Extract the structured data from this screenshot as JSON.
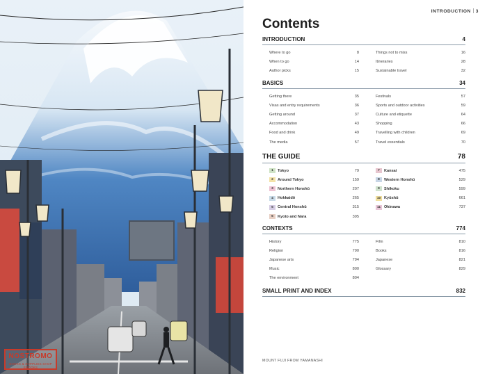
{
  "running_head": "INTRODUCTION",
  "folio": "3",
  "title": "Contents",
  "watermark": {
    "main": "NOSTROMO",
    "sub": "BOOKS & SUPPLIES SHOP EBOOKS"
  },
  "caption": "MOUNT FUJI FROM YAMANASHI",
  "sections": {
    "introduction": {
      "heading": "INTRODUCTION",
      "page": "4",
      "left": [
        {
          "label": "Where to go",
          "page": "8"
        },
        {
          "label": "When to go",
          "page": "14"
        },
        {
          "label": "Author picks",
          "page": "15"
        }
      ],
      "right": [
        {
          "label": "Things not to miss",
          "page": "16"
        },
        {
          "label": "Itineraries",
          "page": "28"
        },
        {
          "label": "Sustainable travel",
          "page": "32"
        }
      ]
    },
    "basics": {
      "heading": "BASICS",
      "page": "34",
      "left": [
        {
          "label": "Getting there",
          "page": "35"
        },
        {
          "label": "Visas and entry requirements",
          "page": "36"
        },
        {
          "label": "Getting around",
          "page": "37"
        },
        {
          "label": "Accommodation",
          "page": "43"
        },
        {
          "label": "Food and drink",
          "page": "49"
        },
        {
          "label": "The media",
          "page": "57"
        }
      ],
      "right": [
        {
          "label": "Festivals",
          "page": "57"
        },
        {
          "label": "Sports and outdoor activities",
          "page": "59"
        },
        {
          "label": "Culture and etiquette",
          "page": "64"
        },
        {
          "label": "Shopping",
          "page": "66"
        },
        {
          "label": "Travelling with children",
          "page": "69"
        },
        {
          "label": "Travel essentials",
          "page": "70"
        }
      ]
    },
    "guide": {
      "heading": "THE GUIDE",
      "page": "78",
      "left": [
        {
          "n": "1",
          "label": "Tokyo",
          "page": "79",
          "color": "#cfe3c6"
        },
        {
          "n": "2",
          "label": "Around Tokyo",
          "page": "159",
          "color": "#f4e2a8"
        },
        {
          "n": "3",
          "label": "Northern Honshū",
          "page": "207",
          "color": "#eec3d3"
        },
        {
          "n": "4",
          "label": "Hokkaidō",
          "page": "265",
          "color": "#c9dbe8"
        },
        {
          "n": "5",
          "label": "Central Honshū",
          "page": "315",
          "color": "#d6cde4"
        },
        {
          "n": "6",
          "label": "Kyoto and Nara",
          "page": "395",
          "color": "#e8d0c4"
        }
      ],
      "right": [
        {
          "n": "7",
          "label": "Kansai",
          "page": "475",
          "color": "#e7c6cf"
        },
        {
          "n": "8",
          "label": "Western Honshū",
          "page": "529",
          "color": "#c8d6e6"
        },
        {
          "n": "9",
          "label": "Shikoku",
          "page": "599",
          "color": "#cfe2cd"
        },
        {
          "n": "10",
          "label": "Kyūshū",
          "page": "661",
          "color": "#f1df9e"
        },
        {
          "n": "11",
          "label": "Okinawa",
          "page": "737",
          "color": "#e9c7d8"
        }
      ]
    },
    "contexts": {
      "heading": "CONTEXTS",
      "page": "774",
      "left": [
        {
          "label": "History",
          "page": "775"
        },
        {
          "label": "Religion",
          "page": "790"
        },
        {
          "label": "Japanese arts",
          "page": "794"
        },
        {
          "label": "Music",
          "page": "800"
        },
        {
          "label": "The environment",
          "page": "804"
        }
      ],
      "right": [
        {
          "label": "Film",
          "page": "810"
        },
        {
          "label": "Books",
          "page": "816"
        },
        {
          "label": "Japanese",
          "page": "821"
        },
        {
          "label": "Glossary",
          "page": "829"
        }
      ]
    },
    "small_print": {
      "heading": "SMALL PRINT AND INDEX",
      "page": "832"
    }
  }
}
